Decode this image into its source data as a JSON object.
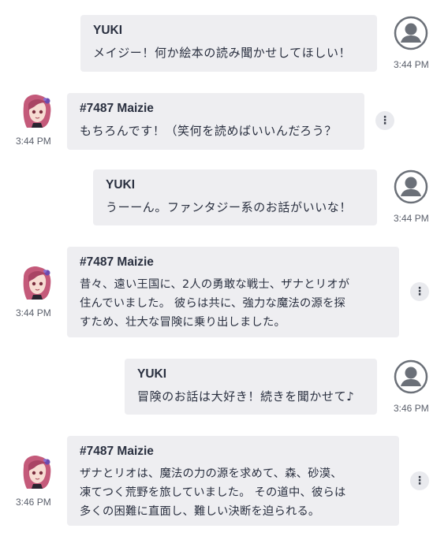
{
  "messages": [
    {
      "sender": "YUKI",
      "text": "メイジー！何か絵本の読み聞かせしてほしい！",
      "time": "3:44 PM"
    },
    {
      "sender": "#7487 Maizie",
      "text": "もちろんです！（笑何を読めばいいんだろう？",
      "time": "3:44 PM"
    },
    {
      "sender": "YUKI",
      "text": "うーーん。ファンタジー系のお話がいいな！",
      "time": "3:44 PM"
    },
    {
      "sender": "#7487 Maizie",
      "text": "昔々、遠い王国に、2人の勇敢な戦士、ザナとリオが\n住んでいました。 彼らは共に、強力な魔法の源を探\nすため、壮大な冒険に乗り出しました。",
      "time": "3:44 PM"
    },
    {
      "sender": "YUKI",
      "text": "冒険のお話は大好き！続きを聞かせて♪",
      "time": "3:46 PM"
    },
    {
      "sender": "#7487 Maizie",
      "text": "ザナとリオは、魔法の力の源を求めて、森、砂漠、\n凍てつく荒野を旅していました。 その道中、彼らは\n多くの困難に直面し、難しい決断を迫られる。",
      "time": "3:46 PM"
    }
  ],
  "colors": {
    "bubble": "#eeeef1",
    "user_avatar": "#6b7078",
    "more_button": "#e9eaee"
  },
  "icons": {
    "user_avatar": "user-silhouette-icon",
    "more": "vertical-dots-icon"
  }
}
